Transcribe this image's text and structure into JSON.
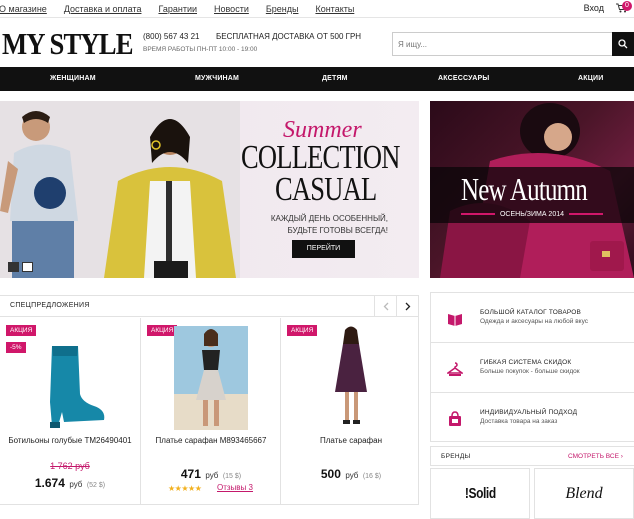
{
  "topbar": {
    "links": [
      "О магазине",
      "Доставка и оплата",
      "Гарантии",
      "Новости",
      "Бренды",
      "Контакты"
    ],
    "login": "Вход",
    "cart_count": "0"
  },
  "header": {
    "logo": "MY STYLE",
    "phone": "(800) 567 43 21",
    "delivery": "БЕСПЛАТНАЯ ДОСТАВКА ОТ 500 ГРН",
    "hours": "ВРЕМЯ РАБОТЫ ПН-ПТ 10:00 - 19:00",
    "search_placeholder": "Я ищу..."
  },
  "nav": [
    "ЖЕНЩИНАМ",
    "МУЖЧИНАМ",
    "ДЕТЯМ",
    "АКСЕССУАРЫ",
    "АКЦИИ"
  ],
  "hero": {
    "script": "Summer",
    "title_line1": "COLLECTION",
    "title_line2": "CASUAL",
    "subtitle": "КАЖДЫЙ ДЕНЬ ОСОБЕННЫЙ, БУДЬТЕ ГОТОВЫ ВСЕГДА!",
    "button": "ПЕРЕЙТИ"
  },
  "autumn": {
    "title": "New Autumn",
    "subtitle": "ОСЕНЬ/ЗИМА 2014"
  },
  "offers": {
    "title": "СПЕЦПРЕДЛОЖЕНИЯ",
    "products": [
      {
        "badge": "АКЦИЯ",
        "discount": "-5%",
        "name": "Ботильоны голубые TM26490401",
        "old_price": "1 762 руб",
        "price": "1.674",
        "currency": "руб",
        "usd": "(52 $)"
      },
      {
        "badge": "АКЦИЯ",
        "name": "Платье сарафан M893465667",
        "price": "471",
        "currency": "руб",
        "usd": "(15 $)",
        "stars": "★★★★★",
        "reviews": "Отзывы 3"
      },
      {
        "badge": "АКЦИЯ",
        "name": "Платье сарафан",
        "price": "500",
        "currency": "руб",
        "usd": "(16 $)"
      }
    ]
  },
  "features": [
    {
      "title": "БОЛЬШОЙ КАТАЛОГ ТОВАРОВ",
      "desc": "Одежда и аксесуары на любой вкус"
    },
    {
      "title": "ГИБКАЯ СИСТЕМА СКИДОК",
      "desc": "Больше покупок - больше скидок"
    },
    {
      "title": "ИНДИВИДУАЛЬНЫЙ ПОДХОД",
      "desc": "Доставка товара на заказ"
    }
  ],
  "brands": {
    "title": "БРЕНДЫ",
    "all": "СМОТРЕТЬ ВСЕ ›",
    "items": [
      "!Solid",
      "Blend"
    ]
  },
  "colors": {
    "accent": "#d0176a",
    "dark": "#111111",
    "border": "#e2e2e2"
  }
}
